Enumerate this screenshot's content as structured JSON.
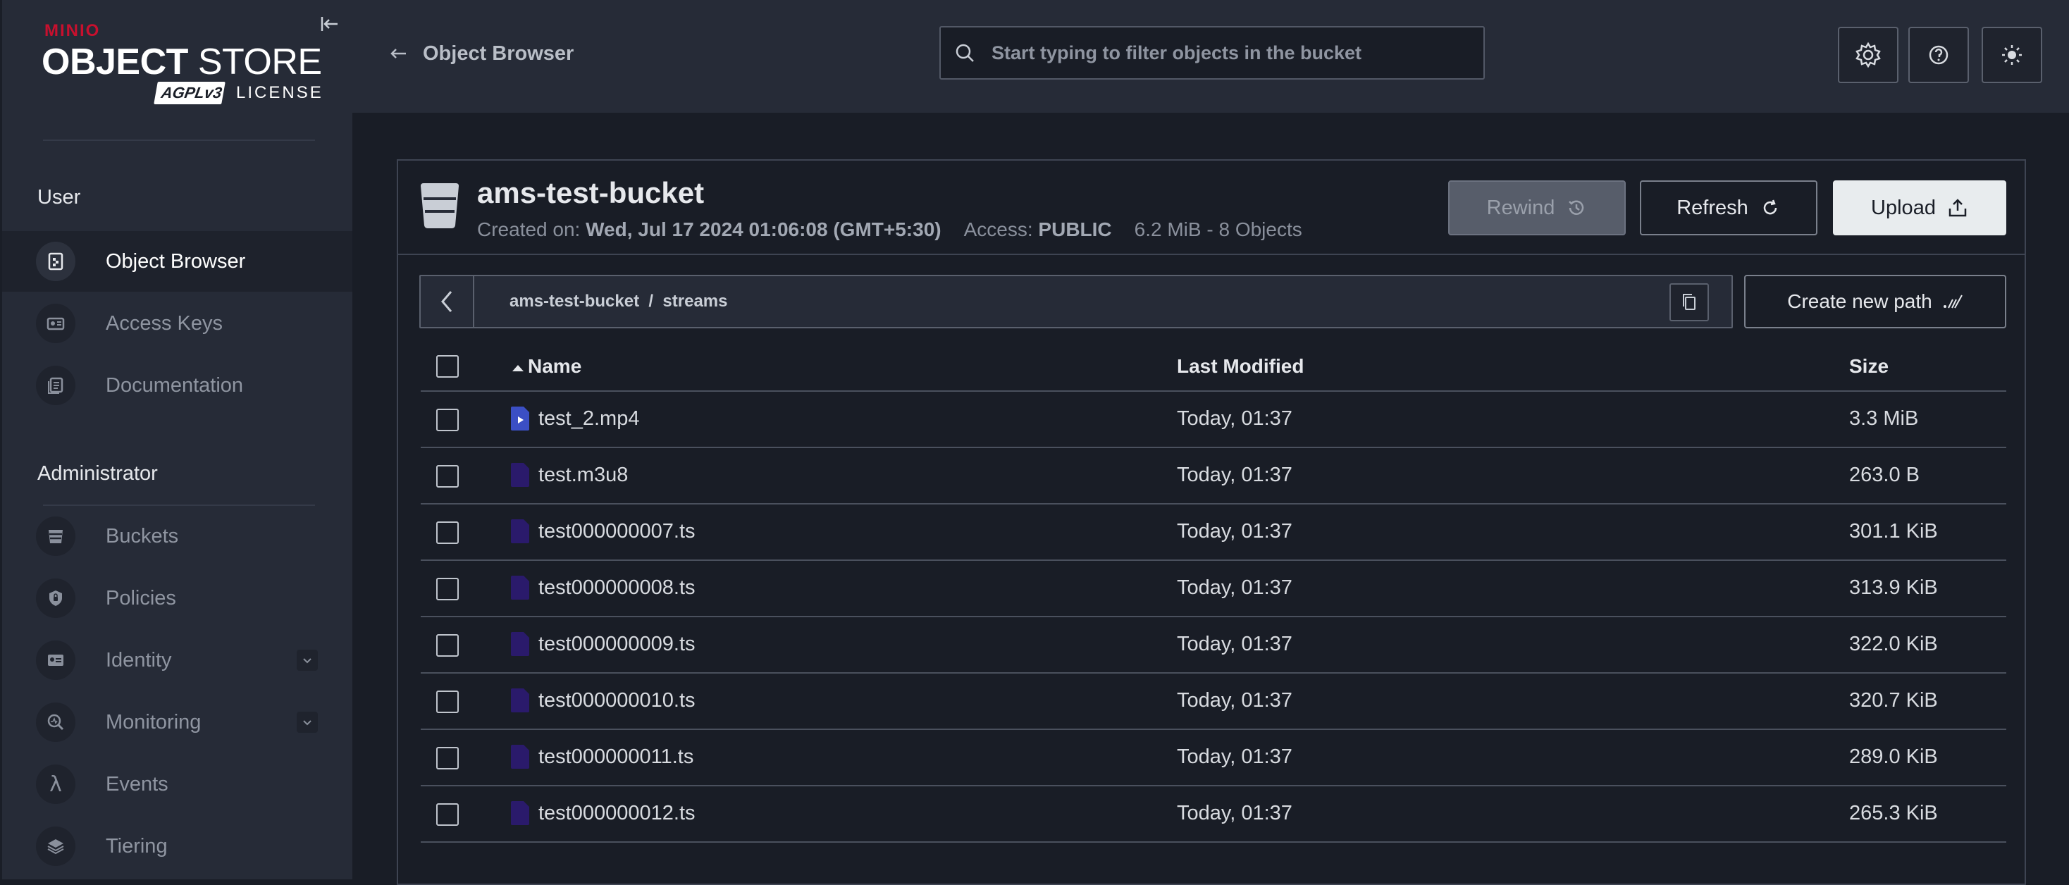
{
  "sidebar": {
    "logo": {
      "brand": "MINIO",
      "product_bold": "OBJECT",
      "product_thin": " STORE",
      "badge": "AGPLv3",
      "license": "LICENSE"
    },
    "sections": [
      {
        "title": "User"
      },
      {
        "title": "Administrator"
      }
    ],
    "user_items": [
      {
        "label": "Object Browser",
        "icon": "object-browser-icon",
        "active": true
      },
      {
        "label": "Access Keys",
        "icon": "access-keys-icon"
      },
      {
        "label": "Documentation",
        "icon": "documentation-icon"
      }
    ],
    "admin_items": [
      {
        "label": "Buckets",
        "icon": "bucket-icon"
      },
      {
        "label": "Policies",
        "icon": "policy-icon"
      },
      {
        "label": "Identity",
        "icon": "identity-icon",
        "expandable": true
      },
      {
        "label": "Monitoring",
        "icon": "monitoring-icon",
        "expandable": true
      },
      {
        "label": "Events",
        "icon": "lambda-icon"
      },
      {
        "label": "Tiering",
        "icon": "tiering-icon"
      }
    ]
  },
  "header": {
    "back_label": "Object Browser",
    "search_placeholder": "Start typing to filter objects in the bucket"
  },
  "bucket": {
    "name": "ams-test-bucket",
    "created_label": "Created on:",
    "created_value": "Wed, Jul 17 2024 01:06:08 (GMT+5:30)",
    "access_label": "Access:",
    "access_value": "PUBLIC",
    "usage": "6.2 MiB - 8 Objects",
    "buttons": {
      "rewind": "Rewind",
      "refresh": "Refresh",
      "upload": "Upload"
    }
  },
  "path": {
    "bucket": "ams-test-bucket",
    "separator": "/",
    "folder": "streams",
    "create_label": "Create new path"
  },
  "table": {
    "columns": {
      "name": "Name",
      "modified": "Last Modified",
      "size": "Size"
    },
    "rows": [
      {
        "name": "test_2.mp4",
        "modified": "Today, 01:37",
        "size": "3.3 MiB",
        "type": "video"
      },
      {
        "name": "test.m3u8",
        "modified": "Today, 01:37",
        "size": "263.0 B",
        "type": "file"
      },
      {
        "name": "test000000007.ts",
        "modified": "Today, 01:37",
        "size": "301.1 KiB",
        "type": "file"
      },
      {
        "name": "test000000008.ts",
        "modified": "Today, 01:37",
        "size": "313.9 KiB",
        "type": "file"
      },
      {
        "name": "test000000009.ts",
        "modified": "Today, 01:37",
        "size": "322.0 KiB",
        "type": "file"
      },
      {
        "name": "test000000010.ts",
        "modified": "Today, 01:37",
        "size": "320.7 KiB",
        "type": "file"
      },
      {
        "name": "test000000011.ts",
        "modified": "Today, 01:37",
        "size": "289.0 KiB",
        "type": "file"
      },
      {
        "name": "test000000012.ts",
        "modified": "Today, 01:37",
        "size": "265.3 KiB",
        "type": "file"
      }
    ]
  },
  "colors": {
    "accent_brand": "#c8102e",
    "file_icon": "#2a1a6b",
    "video_icon": "#3b4fc4"
  }
}
